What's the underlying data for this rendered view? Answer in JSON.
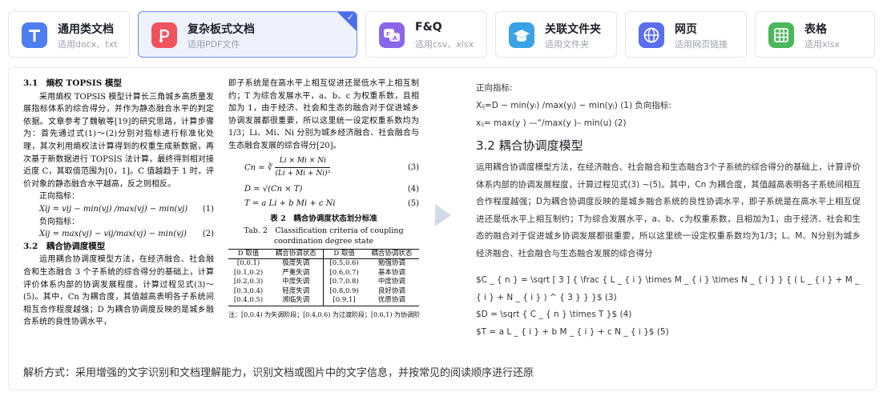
{
  "cards": [
    {
      "title": "通用类文档",
      "subtitle": "适用docx、txt",
      "icon": "letter-t-icon",
      "color": "#4f7ef0",
      "active": false
    },
    {
      "title": "复杂板式文档",
      "subtitle": "适用PDF文件",
      "icon": "pdf-icon",
      "color": "#f0525e",
      "active": true
    },
    {
      "title": "F&Q",
      "subtitle": "适用csv、xlsx",
      "icon": "faq-chat-icon",
      "color": "#8c66e8",
      "active": false
    },
    {
      "title": "关联文件夹",
      "subtitle": "适用文件夹",
      "icon": "graduation-cap-icon",
      "color": "#3aa3e6",
      "active": false
    },
    {
      "title": "网页",
      "subtitle": "适用网页链接",
      "icon": "globe-icon",
      "color": "#5a6ef0",
      "active": false
    },
    {
      "title": "表格",
      "subtitle": "适用xlsx",
      "icon": "spreadsheet-icon",
      "color": "#4cb85b",
      "active": false
    }
  ],
  "paper": {
    "h31": "3.1　熵权 TOPSIS 模型",
    "p1": "采用熵权 TOPSIS 模型计算长三角城乡高质量发展指标体系的综合得分，并作为静态融合水平的判定依据。文章参考了魏敏等[19]的研究思路，计算步骤为：首先通过式(1)～(2)分别对指标进行标准化处理，其次利用熵权法计算得到的权重生成新数据，再次基于新数据进行 TOPSIS 法计算，最终得到相对接近度 C，其取值范围为[0，1]。C 值越趋于 1 时，评价对象的静态融合水平越高，反之则相反。",
    "pos_label": "正向指标：",
    "eq1": "Xij = vij − min(vj) /max(vj) − min(vj)",
    "eq1_num": "(1)",
    "neg_label": "负向指标：",
    "eq2": "Xij = max(vj) − vij/max(vj) − min(vj)",
    "eq2_num": "(2)",
    "h32": "3.2　耦合协调度模型",
    "p2": "运用耦合协调度模型方法，在经济融合、社会融合和生态融合 3 个子系统的综合得分的基础上，计算评价体系内部的协调发展程度，计算过程见式(3)～(5)。其中，Cn 为耦合度，其值越高表明各子系统间相互合作程度越强；D 为耦合协调度反映的是城乡融合系统的良性协调水平，",
    "p3": "即子系统是在高水平上相互促进还是低水平上相互制约；T 为综合发展水平，a、b、c 为权重系数，且相加为 1，由于经济、社会和生态的融合对于促进城乡协调发展都很重要，所以这里统一设定权重系数均为 1/3；Li、Mi、Ni 分别为城乡经济融合、社会融合与生态融合发展的综合得分[20]。",
    "f3_left": "Cn =",
    "f3_num": "Li × Mi × Ni",
    "f3_den": "(Li + Mi + Ni)³",
    "f3_n": "(3)",
    "f4": "D = √(Cn × T)",
    "f4_n": "(4)",
    "f5": "T = a Li + b Mi + c Ni",
    "f5_n": "(5)",
    "table_cap_cn": "表 2　耦合协调度状态划分标准",
    "table_cap_en1": "Tab. 2　Classification criteria of coupling",
    "table_cap_en2": "coordination degree state",
    "table_head": [
      "D 取值",
      "耦合协调状态",
      "D 取值",
      "耦合协调状态"
    ],
    "table_rows": [
      [
        "[0,0.1)",
        "极度失调",
        "[0.5,0.6)",
        "勉强协调"
      ],
      [
        "[0.1,0.2)",
        "严重失调",
        "[0.6,0.7)",
        "基本协调"
      ],
      [
        "[0.2,0.3)",
        "中度失调",
        "[0.7,0.8)",
        "中度协调"
      ],
      [
        "[0.3,0.4)",
        "轻度失调",
        "[0.8,0.9)",
        "良好协调"
      ],
      [
        "[0.4,0.5)",
        "濒临失调",
        "[0.9,1]",
        "优质协调"
      ]
    ],
    "table_note": "注：[0,0.4) 为失调阶段；[0.4,0.6) 为过渡阶段；[0.6,1) 为协调阶"
  },
  "result": {
    "pos_label": "正向指标:",
    "line1": "Xᵢⱼ=D − min(yᵢ) /max(yⱼ) − min(yⱼ) (1) 负向指标:",
    "line2": "xᵢⱼ= max(y ) —“/max(y )– min(u) (2)",
    "heading": "3.2 耦合协调度模型",
    "para": "运用耦合协调度模型方法，在经济融合、社会融合和生态融合3个子系统的综合得分的基础上，计算评价体系内部的协调发展程度，计算过程见式(3) ~(5)。其中，Cn 为耦合度，其值越高表明各子系统间相互合作程度越强；D为耦合协调度反映的是城乡融合系统的良性协调水平，即子系统是在高水平上相互促进还是低水平上相互制约；T为综合发展水平，a、b、c为权重系数，且相加为1，由于经济、社会和生态的融合对于促进城乡协调发展都很重要，所以这里统一设定权重系数均为1/3；L、M、N分别为城乡经济融合、社会融合与生态融合发展的综合得分",
    "math1": "$C _ { n } = \\sqrt [ 3 ] { \\frac { L _ { i } \\times M _ { i } \\times N _ { i } } { ( L _ { i } + M _ { i } + N _ { i } ) ^ { 3 } } }$ (3)",
    "math2": "$D = \\sqrt { C _ { n } \\times T }$ (4)",
    "math3": "$T = a L _ { i } + b M _ { i } + c N _ { i }$ (5)"
  },
  "footer": "解析方式：采用增强的文字识别和文档理解能力，识别文档或图片中的文字信息，并按常见的阅读顺序进行还原"
}
